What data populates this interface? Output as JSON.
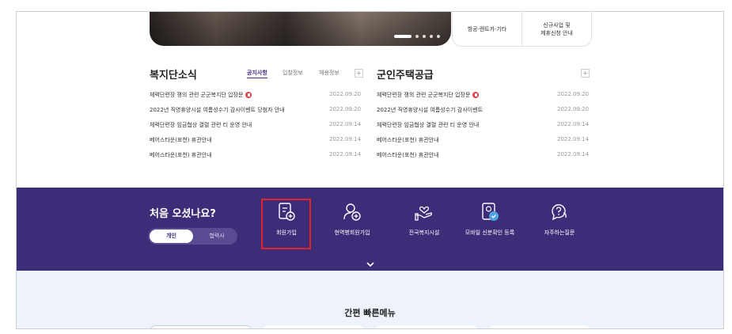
{
  "side_card": [
    {
      "label": "항공·렌트카·기타"
    },
    {
      "label": "신규사업 및\n제휴신청 안내"
    }
  ],
  "news_left": {
    "title": "복지단소식",
    "tabs": [
      "공지사항",
      "입찰정보",
      "채용정보"
    ],
    "items": [
      {
        "title": "체력단련장 쟁의 관련 군군복지단 입장문",
        "date": "2022.09.20",
        "badge": true
      },
      {
        "title": "2022년 직영휴양시설 여름성수기 감사이벤트 당첨자 안내",
        "date": "2022.09.20",
        "badge": false
      },
      {
        "title": "체력단련장 임금협상 결렬 관련 티 운영 안내",
        "date": "2022.09.14",
        "badge": false
      },
      {
        "title": "베어스타운(포천) 휴관안내",
        "date": "2022.09.14",
        "badge": false
      },
      {
        "title": "베어스타운(포천) 휴관안내",
        "date": "2022.09.14",
        "badge": false
      }
    ]
  },
  "news_right": {
    "title": "군인주택공급",
    "items": [
      {
        "title": "체력단련장 쟁의 관련 군군복지단 입장문",
        "date": "2022.09.20",
        "badge": true
      },
      {
        "title": "2022년 직영휴양시설 여름성수기 감사이벤트",
        "date": "2022.09.20",
        "badge": false
      },
      {
        "title": "체력단련장 임금협상 결렬 관련 티 운영 안내",
        "date": "2022.09.14",
        "badge": false
      },
      {
        "title": "베어스타운(포천) 휴관안내",
        "date": "2022.09.14",
        "badge": false
      },
      {
        "title": "베어스타운(포천) 휴관안내",
        "date": "2022.09.14",
        "badge": false
      }
    ]
  },
  "plus_symbol": "+",
  "band": {
    "title": "처음 오셨나요?",
    "toggle": {
      "on": "개인",
      "off": "협력사"
    },
    "menu": [
      {
        "label": "회원가입",
        "icon": "document-plus-icon"
      },
      {
        "label": "현역병회원가입",
        "icon": "user-plus-icon"
      },
      {
        "label": "전국복지시설",
        "icon": "heart-hand-icon"
      },
      {
        "label": "모바일 신분확인 등록",
        "icon": "id-card-icon"
      },
      {
        "label": "자주하는질문",
        "icon": "question-bubble-icon"
      }
    ]
  },
  "quick_menu": {
    "title": "간편 빠른메뉴"
  },
  "colors": {
    "purple": "#3d2c78",
    "badge": "#e8414c",
    "highlight": "#e0242b",
    "lower_bg": "#eef3fb"
  }
}
